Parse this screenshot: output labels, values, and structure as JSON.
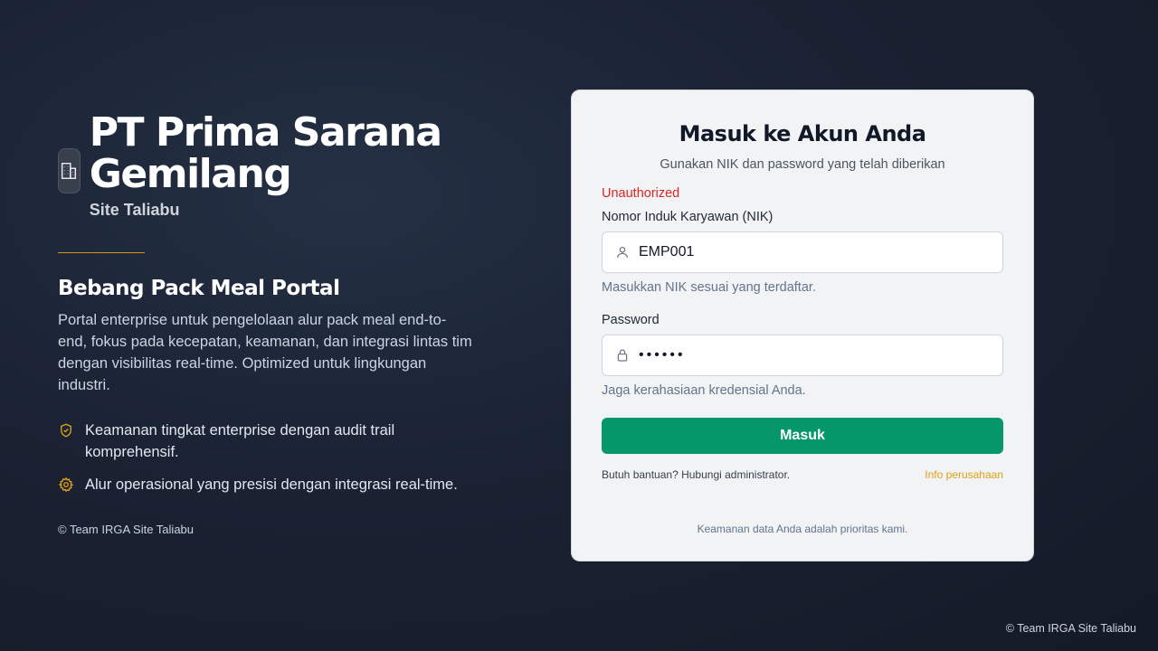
{
  "brand": {
    "company": "PT Prima Sarana Gemilang",
    "site": "Site Taliabu",
    "icon": "building-icon"
  },
  "portal": {
    "title": "Bebang Pack Meal Portal",
    "description": "Portal enterprise untuk pengelolaan alur pack meal end-to-end, fokus pada kecepatan, keamanan, dan integrasi lintas tim dengan visibilitas real-time. Optimized untuk lingkungan industri.",
    "features": [
      {
        "icon": "shield-check-icon",
        "text": "Keamanan tingkat enterprise dengan audit trail komprehensif."
      },
      {
        "icon": "gear-icon",
        "text": "Alur operasional yang presisi dengan integrasi real-time."
      }
    ],
    "copyright": "© Team IRGA Site Taliabu"
  },
  "login": {
    "title": "Masuk ke Akun Anda",
    "subtitle": "Gunakan NIK dan password yang telah diberikan",
    "error": "Unauthorized",
    "nik_label": "Nomor Induk Karyawan (NIK)",
    "nik_value": "EMP001",
    "nik_hint": "Masukkan NIK sesuai yang terdaftar.",
    "password_label": "Password",
    "password_value": "••••••",
    "password_hint": "Jaga kerahasiaan kredensial Anda.",
    "submit_label": "Masuk",
    "help_text": "Butuh bantuan? Hubungi administrator.",
    "info_link": "Info perusahaan",
    "footer_note": "Keamanan data Anda adalah prioritas kami."
  },
  "footer": {
    "copyright": "© Team IRGA Site Taliabu"
  },
  "colors": {
    "accent": "#059669",
    "error": "#dc2626",
    "gold": "#e0a115"
  }
}
